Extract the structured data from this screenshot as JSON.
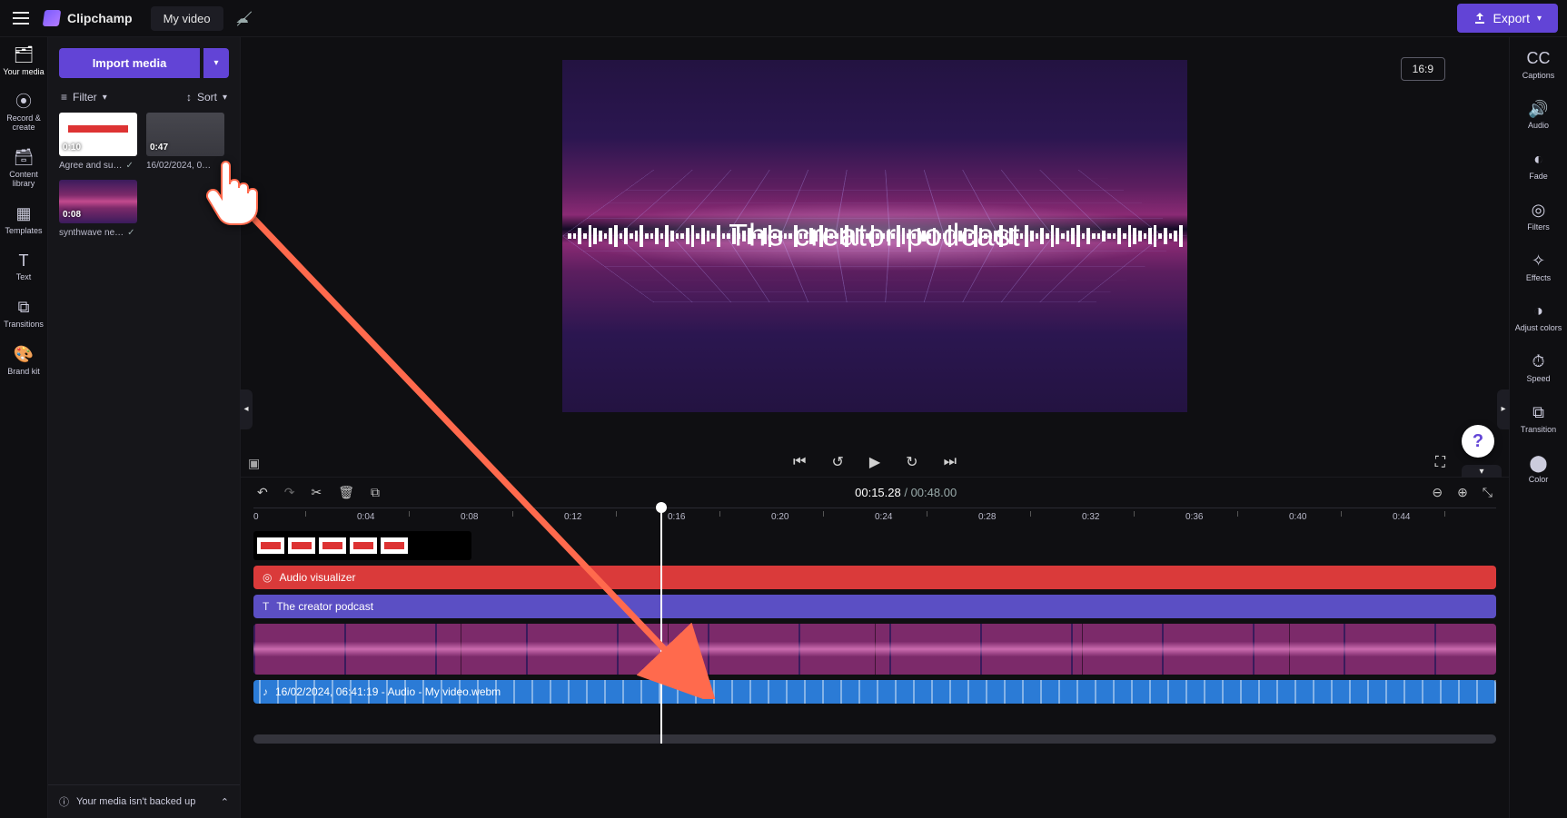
{
  "topbar": {
    "brand": "Clipchamp",
    "project": "My video",
    "export": "Export"
  },
  "left_tools": [
    {
      "label": "Your media",
      "icon": "🗂"
    },
    {
      "label": "Record & create",
      "icon": "⦿"
    },
    {
      "label": "Content library",
      "icon": "🗃"
    },
    {
      "label": "Templates",
      "icon": "▦"
    },
    {
      "label": "Text",
      "icon": "T"
    },
    {
      "label": "Transitions",
      "icon": "⧉"
    },
    {
      "label": "Brand kit",
      "icon": "🎨"
    }
  ],
  "media_panel": {
    "import": "Import media",
    "filter": "Filter",
    "sort": "Sort",
    "items": [
      {
        "duration": "0:10",
        "name": "Agree and su…",
        "checked": true
      },
      {
        "duration": "0:47",
        "name": "16/02/2024, 0…",
        "checked": false
      },
      {
        "duration": "0:08",
        "name": "synthwave ne…",
        "checked": true
      }
    ],
    "backup_msg": "Your media isn't backed up"
  },
  "preview": {
    "aspect": "16:9",
    "title": "The creator podcast"
  },
  "playback": {
    "current": "00:15.28",
    "sep": " / ",
    "total": "00:48.00"
  },
  "ruler_ticks": [
    "0",
    "0:04",
    "0:08",
    "0:12",
    "0:16",
    "0:20",
    "0:24",
    "0:28",
    "0:32",
    "0:36",
    "0:40",
    "0:44"
  ],
  "tracks": {
    "visualizer": "Audio visualizer",
    "text": "The creator podcast",
    "audio": "16/02/2024, 06:41:19 - Audio - My video.webm"
  },
  "right_tools": [
    {
      "label": "Captions",
      "icon": "CC"
    },
    {
      "label": "Audio",
      "icon": "🔊"
    },
    {
      "label": "Fade",
      "icon": "◐"
    },
    {
      "label": "Filters",
      "icon": "◎"
    },
    {
      "label": "Effects",
      "icon": "✧"
    },
    {
      "label": "Adjust colors",
      "icon": "◑"
    },
    {
      "label": "Speed",
      "icon": "⏱"
    },
    {
      "label": "Transition",
      "icon": "⧉"
    },
    {
      "label": "Color",
      "icon": "⬤"
    }
  ]
}
